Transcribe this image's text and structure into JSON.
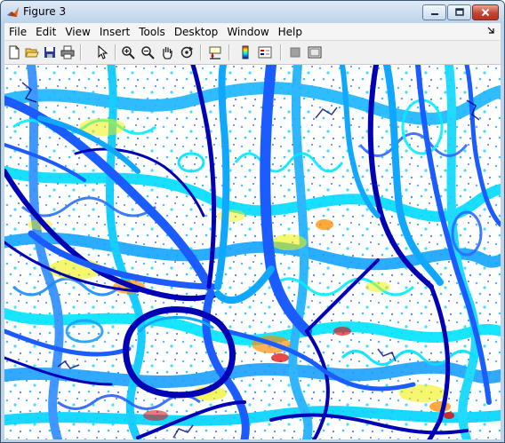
{
  "window": {
    "title": "Figure 3"
  },
  "menu": {
    "items": [
      "File",
      "Edit",
      "View",
      "Insert",
      "Tools",
      "Desktop",
      "Window",
      "Help"
    ]
  },
  "toolbar": {
    "buttons": [
      "new-figure-icon",
      "open-file-icon",
      "save-icon",
      "print-icon",
      "edit-plot-icon",
      "zoom-in-icon",
      "zoom-out-icon",
      "pan-icon",
      "rotate-3d-icon",
      "data-cursor-icon",
      "colorbar-icon",
      "legend-icon",
      "hide-plot-tools-icon",
      "show-plot-tools-icon"
    ]
  },
  "plot": {
    "description_colors": {
      "dark_blue": "#0000b4",
      "blue": "#1a5cff",
      "light_blue": "#10a8ff",
      "cyan": "#00e8ff",
      "yellow": "#f0f000",
      "orange": "#ff8c00",
      "red": "#e01010"
    }
  }
}
